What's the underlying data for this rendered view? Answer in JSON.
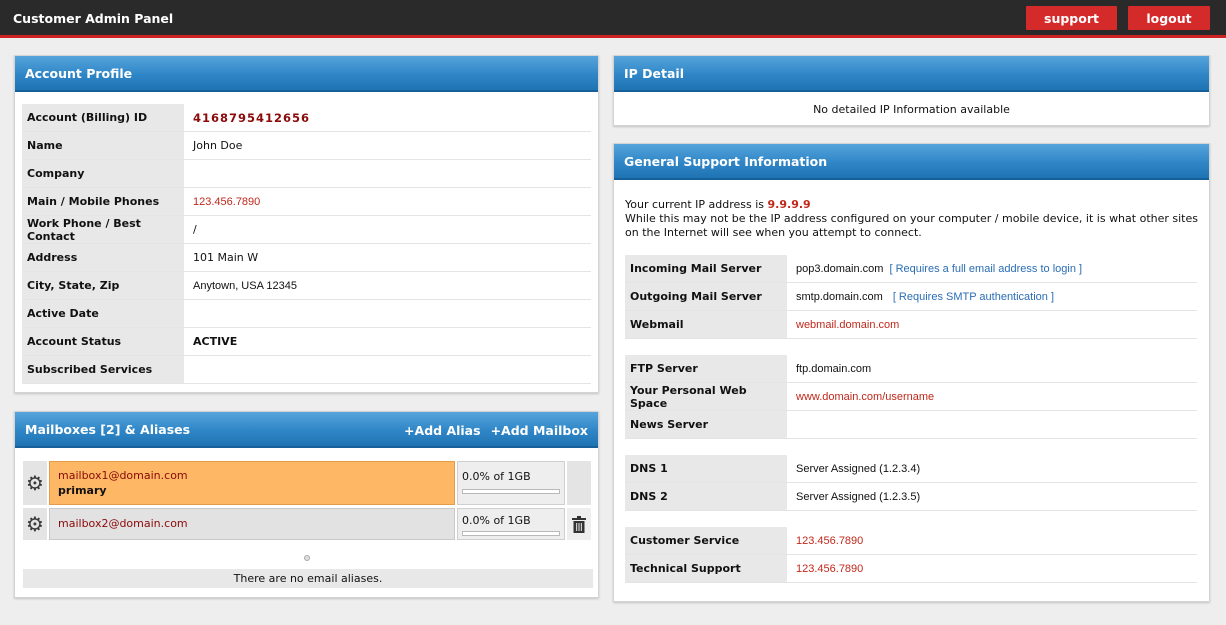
{
  "header": {
    "title": "Customer Admin Panel",
    "support_label": "support",
    "logout_label": "logout"
  },
  "profile": {
    "title": "Account Profile",
    "rows": [
      {
        "key": "Account (Billing) ID",
        "value": "4168795412656"
      },
      {
        "key": "Name",
        "value": "John Doe"
      },
      {
        "key": "Company",
        "value": ""
      },
      {
        "key": "Main / Mobile Phones",
        "value": "123.456.7890"
      },
      {
        "key": "Work Phone / Best Contact",
        "value": "/"
      },
      {
        "key": "Address",
        "value": "101 Main W"
      },
      {
        "key": "City, State, Zip",
        "value": "Anytown, USA 12345"
      },
      {
        "key": "Active Date",
        "value": ""
      },
      {
        "key": "Account Status",
        "value": "ACTIVE"
      },
      {
        "key": "Subscribed Services",
        "value": ""
      }
    ]
  },
  "mailboxes": {
    "title": "Mailboxes [2] & Aliases",
    "add_alias": "+Add Alias",
    "add_mailbox": "+Add Mailbox",
    "items": [
      {
        "address": "mailbox1@domain.com",
        "tag": "primary",
        "quota": "0.0% of 1GB",
        "used_fraction": 0.0
      },
      {
        "address": "mailbox2@domain.com",
        "tag": "",
        "quota": "0.0% of 1GB",
        "used_fraction": 0.0
      }
    ],
    "no_aliases": "There are no email aliases."
  },
  "ip_detail": {
    "title": "IP Detail",
    "message": "No detailed IP Information available"
  },
  "support": {
    "title": "General Support Information",
    "ip_prefix": "Your current IP address is ",
    "ip": "9.9.9.9",
    "ip_note": "While this may not be the IP address configured on your computer / mobile device, it is what other sites on the Internet will see when you attempt to connect.",
    "mail": [
      {
        "key": "Incoming Mail Server",
        "value": "pop3.domain.com",
        "note": "[ Requires a full email address to login ]"
      },
      {
        "key": "Outgoing Mail Server",
        "value": "smtp.domain.com",
        "note": "[ Requires SMTP authentication ]"
      },
      {
        "key": "Webmail",
        "value": "webmail.domain.com",
        "note": ""
      }
    ],
    "web": [
      {
        "key": "FTP Server",
        "value": "ftp.domain.com"
      },
      {
        "key": "Your Personal Web Space",
        "value": "www.domain.com/username"
      },
      {
        "key": "News Server",
        "value": ""
      }
    ],
    "dns": [
      {
        "key": "DNS 1",
        "value": "Server Assigned (1.2.3.4)"
      },
      {
        "key": "DNS 2",
        "value": "Server Assigned (1.2.3.5)"
      }
    ],
    "contacts": [
      {
        "key": "Customer Service",
        "value": "123.456.7890"
      },
      {
        "key": "Technical Support",
        "value": "123.456.7890"
      }
    ]
  },
  "colors": {
    "accent_blue": "#2f86c6",
    "alert_red": "#d52a2a",
    "primary_mailbox": "#fdb765"
  }
}
